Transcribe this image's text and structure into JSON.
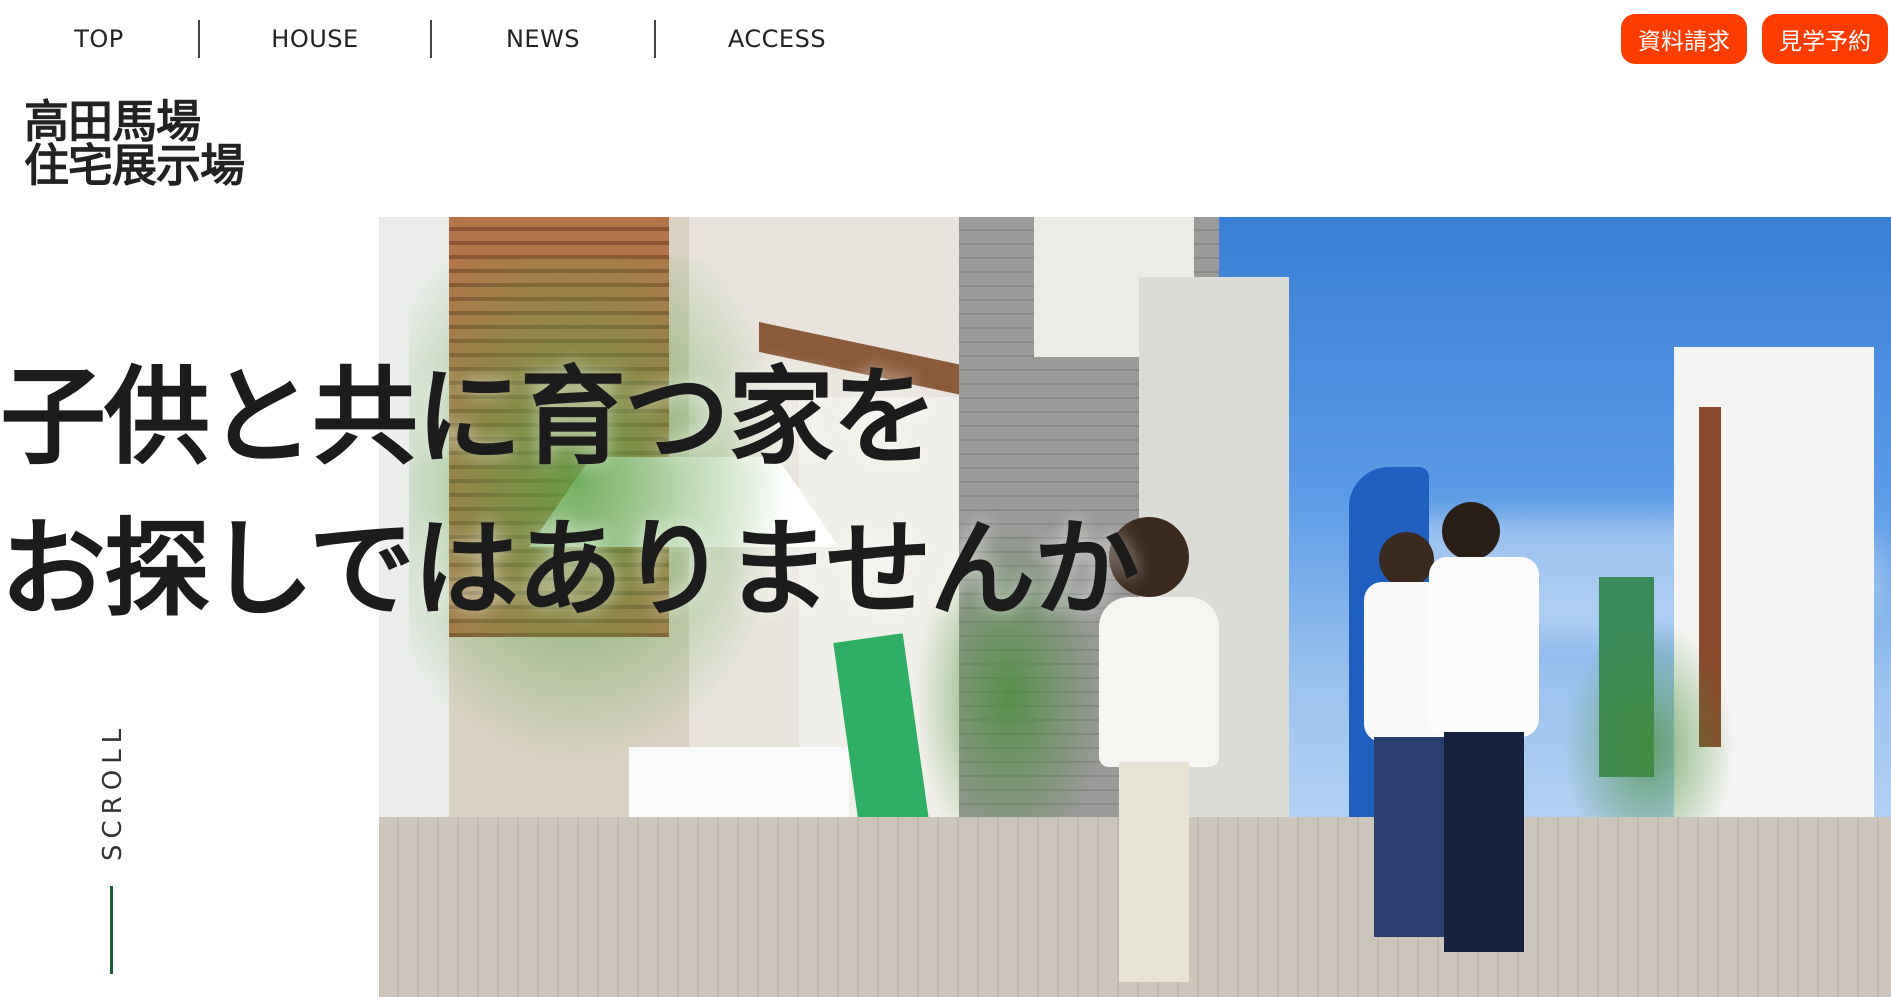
{
  "nav": {
    "items": [
      {
        "label": "TOP"
      },
      {
        "label": "HOUSE"
      },
      {
        "label": "NEWS"
      },
      {
        "label": "ACCESS"
      }
    ]
  },
  "cta": {
    "request_docs": "資料請求",
    "visit_reservation": "見学予約"
  },
  "logo": {
    "line1": "高田馬場",
    "line2": "住宅展示場"
  },
  "hero": {
    "headline_line1": "子供と共に育つ家を",
    "headline_line2": "お探しではありませんか"
  },
  "scroll": {
    "label": "SCROLL"
  },
  "colors": {
    "accent": "#ff3c00",
    "scroll_line": "#1f5a36",
    "sky": "#3a7fd6"
  }
}
